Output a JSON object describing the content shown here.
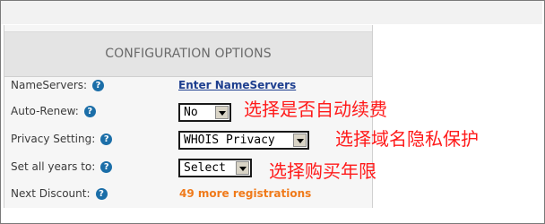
{
  "header": {
    "title": "CONFIGURATION OPTIONS"
  },
  "rows": {
    "nameservers": {
      "label": "NameServers:",
      "link": "Enter NameServers"
    },
    "auto_renew": {
      "label": "Auto-Renew:",
      "selected": "No"
    },
    "privacy": {
      "label": "Privacy Setting:",
      "selected": "WHOIS Privacy"
    },
    "years": {
      "label": "Set all years to:",
      "selected": "Select"
    },
    "discount": {
      "label": "Next Discount:",
      "value": "49 more registrations"
    }
  },
  "help_icon_glyph": "?",
  "annotations": {
    "auto_renew": "选择是否自动续费",
    "privacy": "选择域名隐私保护",
    "years": "选择购买年限"
  },
  "colors": {
    "link": "#1e3f8f",
    "help_icon": "#1b6ea8",
    "discount": "#f07a1a",
    "annotation": "#ff1a1a"
  },
  "icons": {
    "help": "question-mark-circle-icon",
    "dropdown": "chevron-down-icon"
  }
}
